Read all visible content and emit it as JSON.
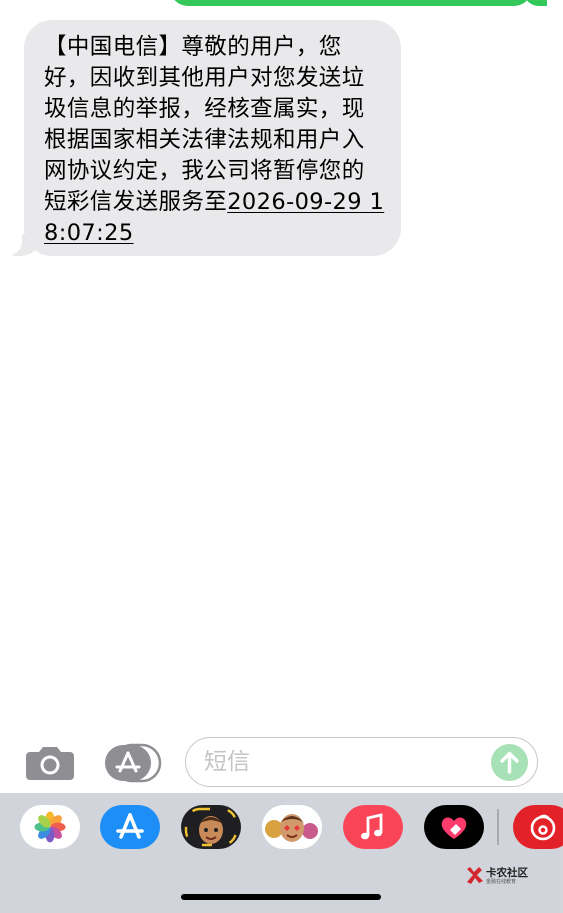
{
  "conversation": {
    "incoming_message": {
      "text_main": "【中国电信】尊敬的用户，您好，因收到其他用户对您发送垃圾信息的举报，经核查属实，现根据国家相关法律法规和用户入网协议约定，我公司将暂停您的短彩信发送服务至",
      "text_link": "2026-09-29 18:07:25"
    }
  },
  "input_bar": {
    "placeholder": "短信"
  },
  "app_drawer": {
    "apps": [
      {
        "name": "photos-icon"
      },
      {
        "name": "app-store-icon"
      },
      {
        "name": "memoji-sticker-icon"
      },
      {
        "name": "animoji-icon"
      },
      {
        "name": "music-icon"
      },
      {
        "name": "digital-touch-icon"
      },
      {
        "name": "netease-music-icon"
      }
    ]
  },
  "watermark": {
    "title": "卡农社区",
    "subtitle": "金融在线教育"
  },
  "colors": {
    "outgoing_bubble": "#34c759",
    "incoming_bubble": "#e9e9eb",
    "send_button_disabled": "#a7e2b6",
    "drawer_background": "#d2d4db"
  }
}
